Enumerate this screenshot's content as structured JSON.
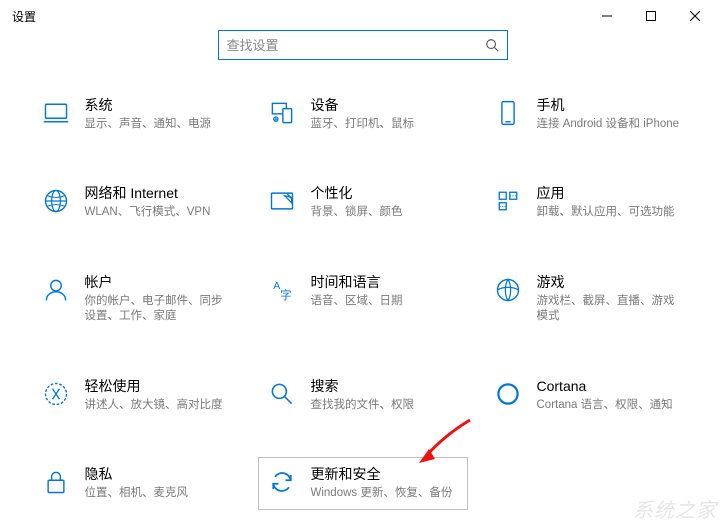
{
  "window": {
    "title": "设置"
  },
  "search": {
    "placeholder": "查找设置"
  },
  "tiles": [
    {
      "key": "system",
      "title": "系统",
      "sub": "显示、声音、通知、电源"
    },
    {
      "key": "devices",
      "title": "设备",
      "sub": "蓝牙、打印机、鼠标"
    },
    {
      "key": "phone",
      "title": "手机",
      "sub": "连接 Android 设备和 iPhone"
    },
    {
      "key": "network",
      "title": "网络和 Internet",
      "sub": "WLAN、飞行模式、VPN"
    },
    {
      "key": "personal",
      "title": "个性化",
      "sub": "背景、锁屏、颜色"
    },
    {
      "key": "apps",
      "title": "应用",
      "sub": "卸载、默认应用、可选功能"
    },
    {
      "key": "accounts",
      "title": "帐户",
      "sub": "你的帐户、电子邮件、同步设置、工作、家庭"
    },
    {
      "key": "time",
      "title": "时间和语言",
      "sub": "语音、区域、日期"
    },
    {
      "key": "gaming",
      "title": "游戏",
      "sub": "游戏栏、截屏、直播、游戏模式"
    },
    {
      "key": "ease",
      "title": "轻松使用",
      "sub": "讲述人、放大镜、高对比度"
    },
    {
      "key": "search",
      "title": "搜索",
      "sub": "查找我的文件、权限"
    },
    {
      "key": "cortana",
      "title": "Cortana",
      "sub": "Cortana 语言、权限、通知"
    },
    {
      "key": "privacy",
      "title": "隐私",
      "sub": "位置、相机、麦克风"
    },
    {
      "key": "update",
      "title": "更新和安全",
      "sub": "Windows 更新、恢复、备份",
      "highlight": true
    }
  ],
  "watermark": "系统之家"
}
